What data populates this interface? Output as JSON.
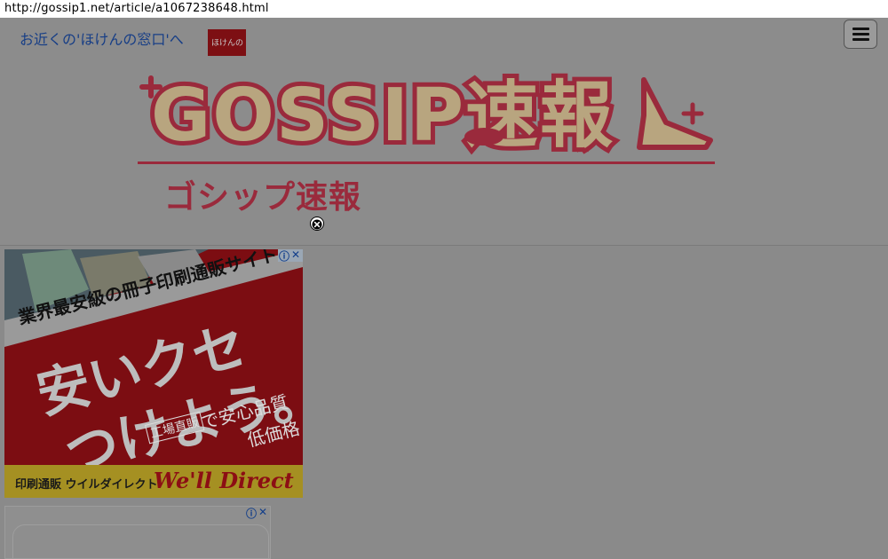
{
  "url": "http://gossip1.net/article/a1067238648.html",
  "site": {
    "logo_wordmark": "GOSSIP速報",
    "logo_subtitle": "ゴシップ速報"
  },
  "menu": {
    "icon": "hamburger-menu-icon"
  },
  "overlay": {
    "close_icon": "close-circle-icon"
  },
  "ad_banner": {
    "headline": "業界最安級の冊子印刷通販サイト",
    "slogan_line1": "安いクセ",
    "slogan_line2": "つけよう。",
    "badge": "工場直販",
    "tagline1": "で安心品質",
    "tagline2": "低価格",
    "footer": "印刷通販 ウイルダイレクト",
    "brand": "We'll Direct",
    "info_icon": "adchoices-info-icon",
    "close_icon": "ad-close-icon"
  },
  "ad_text": {
    "text": "お近くの'ほけんの窓口'へ",
    "thumb_label": "ほけんの",
    "info_icon": "adchoices-info-icon",
    "close_icon": "ad-close-icon"
  },
  "colors": {
    "overlay_gray": "#8a8a8a",
    "logo_red": "#9a2a3c",
    "logo_beige": "#b8a57f",
    "ad_red": "#7c0d12",
    "ad_link_blue": "#173e86"
  }
}
